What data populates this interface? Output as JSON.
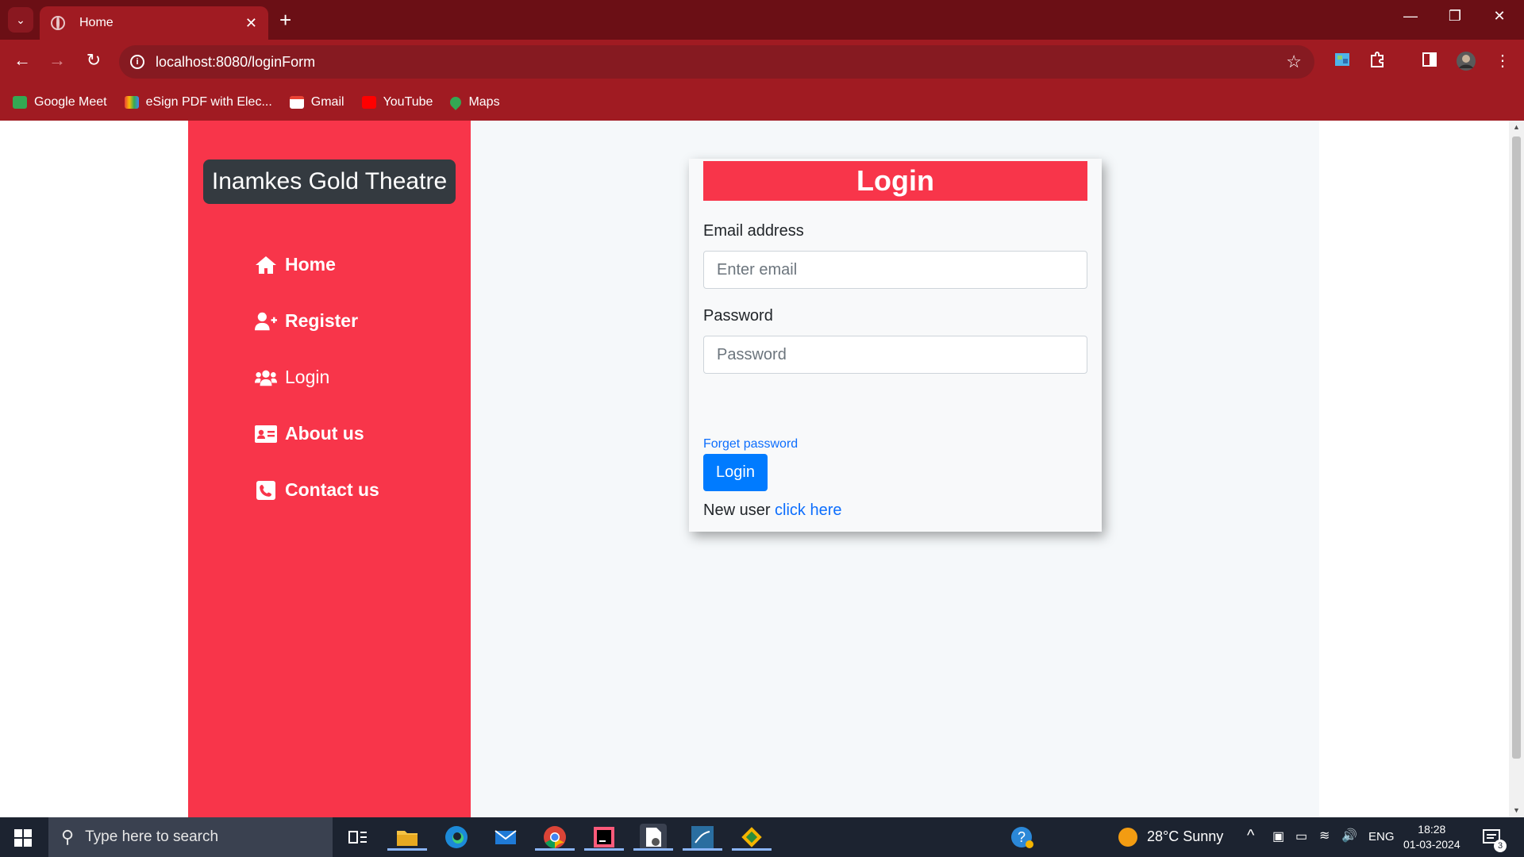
{
  "browser": {
    "tab_title": "Home",
    "url": "localhost:8080/loginForm",
    "bookmarks": [
      {
        "label": "Google Meet",
        "color": "#34a853"
      },
      {
        "label": "eSign PDF with Elec...",
        "color": "#f4b400"
      },
      {
        "label": "Gmail",
        "color": "#ea4335"
      },
      {
        "label": "YouTube",
        "color": "#ff0000"
      },
      {
        "label": "Maps",
        "color": "#4285f4"
      }
    ]
  },
  "sidebar": {
    "brand": "Inamkes Gold Theatre",
    "items": [
      {
        "label": "Home",
        "icon": "home-icon"
      },
      {
        "label": "Register",
        "icon": "user-plus-icon"
      },
      {
        "label": "Login",
        "icon": "users-icon"
      },
      {
        "label": "About us",
        "icon": "id-card-icon"
      },
      {
        "label": "Contact us",
        "icon": "phone-square-icon"
      }
    ]
  },
  "login": {
    "heading": "Login",
    "email_label": "Email address",
    "email_placeholder": "Enter email",
    "password_label": "Password",
    "password_placeholder": "Password",
    "forgot_link": "Forget password",
    "submit_label": "Login",
    "new_user_text": "New user",
    "new_user_link": "click here"
  },
  "taskbar": {
    "search_placeholder": "Type here to search",
    "weather": "28°C  Sunny",
    "language": "ENG",
    "time": "18:28",
    "date": "01-03-2024",
    "notifications": "3"
  },
  "colors": {
    "brand_red": "#f8354a",
    "chrome_red": "#a01b22",
    "primary_blue": "#007bff"
  }
}
